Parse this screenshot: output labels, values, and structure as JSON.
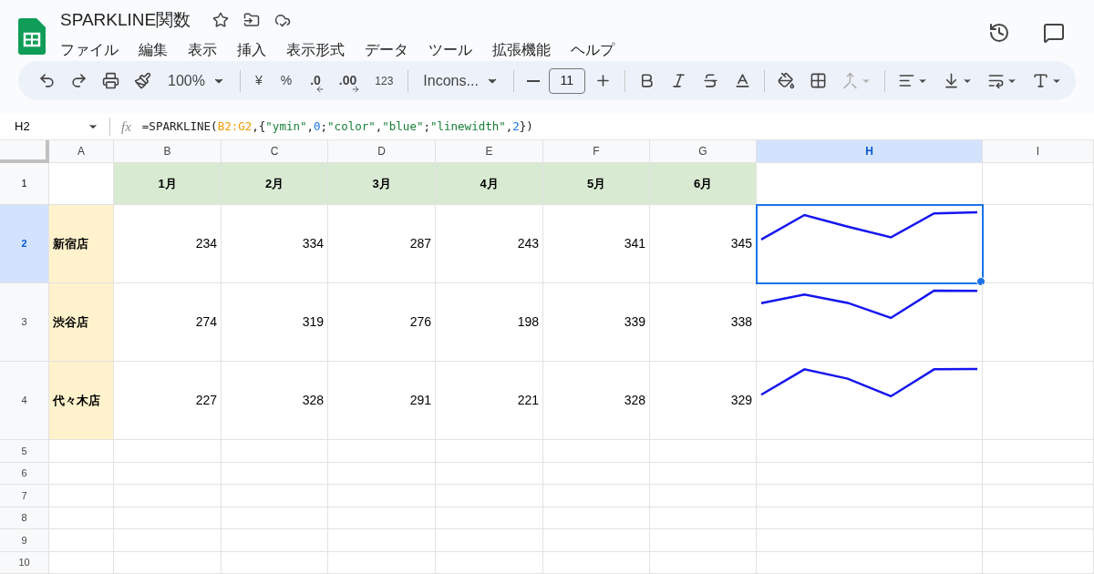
{
  "doc": {
    "title": "SPARKLINE関数"
  },
  "menu": [
    "ファイル",
    "編集",
    "表示",
    "挿入",
    "表示形式",
    "データ",
    "ツール",
    "拡張機能",
    "ヘルプ"
  ],
  "toolbar": [
    {
      "kind": "undo"
    },
    {
      "kind": "redo"
    },
    {
      "kind": "print"
    },
    {
      "kind": "paint"
    },
    {
      "kind": "dropdown",
      "label": "100%"
    },
    {
      "kind": "sep"
    },
    {
      "kind": "text",
      "label": "¥"
    },
    {
      "kind": "text",
      "label": "%"
    },
    {
      "kind": "decdown",
      "label": ".0"
    },
    {
      "kind": "decup",
      "label": ".00"
    },
    {
      "kind": "small",
      "label": "123"
    },
    {
      "kind": "sep"
    },
    {
      "kind": "dropdown",
      "label": "Incons..."
    },
    {
      "kind": "sep"
    },
    {
      "kind": "minus"
    },
    {
      "kind": "size",
      "label": "11"
    },
    {
      "kind": "plus"
    },
    {
      "kind": "sep"
    },
    {
      "kind": "bold"
    },
    {
      "kind": "italic"
    },
    {
      "kind": "strike"
    },
    {
      "kind": "textcolor"
    },
    {
      "kind": "sep"
    },
    {
      "kind": "fill"
    },
    {
      "kind": "borders"
    },
    {
      "kind": "merge",
      "disabled": true
    },
    {
      "kind": "sep"
    },
    {
      "kind": "align"
    },
    {
      "kind": "valign"
    },
    {
      "kind": "wrap"
    },
    {
      "kind": "rotate"
    }
  ],
  "name_box": "H2",
  "function_label": "fx",
  "formula": [
    {
      "kind": "plain",
      "text": "=SPARKLINE("
    },
    {
      "kind": "range",
      "text": "B2:G2"
    },
    {
      "kind": "plain",
      "text": ",{"
    },
    {
      "kind": "string",
      "text": "\"ymin\""
    },
    {
      "kind": "plain",
      "text": ","
    },
    {
      "kind": "number",
      "text": "0"
    },
    {
      "kind": "plain",
      "text": ";"
    },
    {
      "kind": "string",
      "text": "\"color\""
    },
    {
      "kind": "plain",
      "text": ","
    },
    {
      "kind": "string",
      "text": "\"blue\""
    },
    {
      "kind": "plain",
      "text": ";"
    },
    {
      "kind": "string",
      "text": "\"linewidth\""
    },
    {
      "kind": "plain",
      "text": ","
    },
    {
      "kind": "number",
      "text": "2"
    },
    {
      "kind": "plain",
      "text": "})"
    }
  ],
  "columns": [
    {
      "label": "A",
      "selected": false
    },
    {
      "label": "B",
      "selected": false
    },
    {
      "label": "C",
      "selected": false
    },
    {
      "label": "D",
      "selected": false
    },
    {
      "label": "E",
      "selected": false
    },
    {
      "label": "F",
      "selected": false
    },
    {
      "label": "G",
      "selected": false
    },
    {
      "label": "H",
      "selected": true
    },
    {
      "label": "I",
      "selected": false
    }
  ],
  "header_row": {
    "label": "1",
    "selected": false,
    "months": [
      "1月",
      "2月",
      "3月",
      "4月",
      "5月",
      "6月"
    ]
  },
  "rows": [
    {
      "label": "2",
      "selected": true,
      "store": "新宿店",
      "values": [
        "234",
        "334",
        "287",
        "243",
        "341",
        "345"
      ]
    },
    {
      "label": "3",
      "selected": false,
      "store": "渋谷店",
      "values": [
        "274",
        "319",
        "276",
        "198",
        "339",
        "338"
      ]
    },
    {
      "label": "4",
      "selected": false,
      "store": "代々木店",
      "values": [
        "227",
        "328",
        "291",
        "221",
        "328",
        "329"
      ]
    }
  ],
  "empty_rows": [
    "5",
    "6",
    "7",
    "8",
    "9",
    "10"
  ]
}
